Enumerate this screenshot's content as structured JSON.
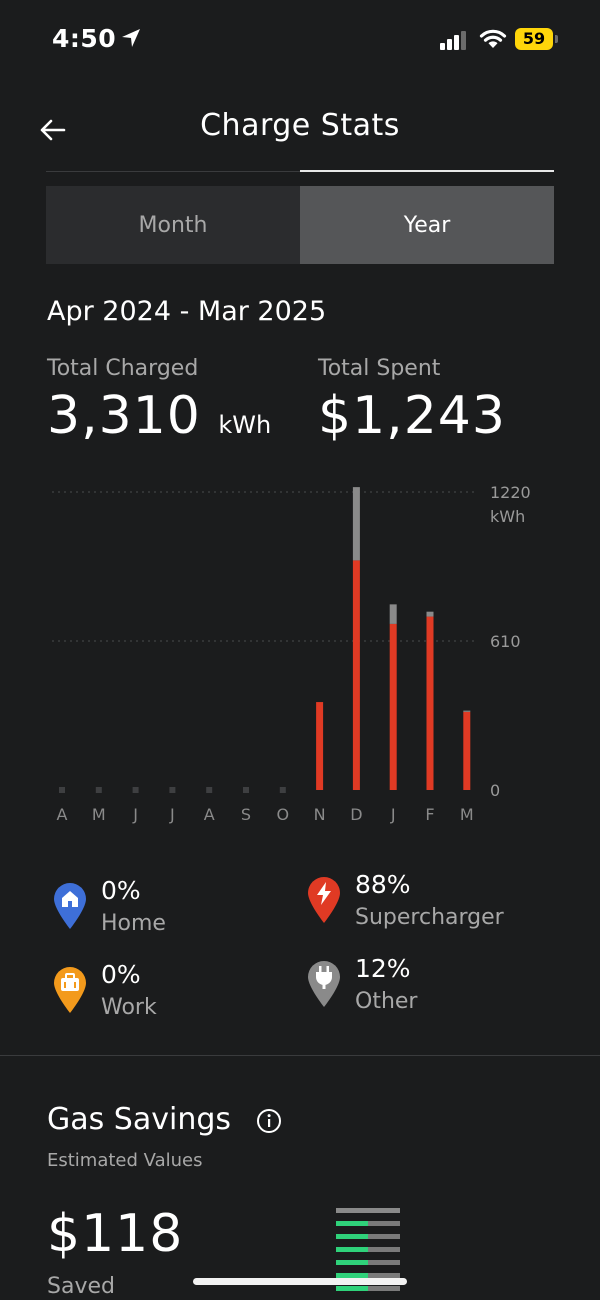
{
  "status_bar": {
    "time": "4:50",
    "battery": "59"
  },
  "header": {
    "title": "Charge Stats"
  },
  "tabs": [
    {
      "label": "Month",
      "active": false
    },
    {
      "label": "Year",
      "active": true
    }
  ],
  "period": "Apr 2024 - Mar 2025",
  "stats": {
    "charged_label": "Total Charged",
    "charged_value": "3,310",
    "charged_unit": "kWh",
    "spent_label": "Total Spent",
    "spent_value": "$1,243"
  },
  "chart_data": {
    "type": "bar",
    "categories": [
      "A",
      "M",
      "J",
      "J",
      "A",
      "S",
      "O",
      "N",
      "D",
      "J",
      "F",
      "M"
    ],
    "series": [
      {
        "values": [
          0,
          0,
          0,
          0,
          0,
          0,
          0,
          360,
          940,
          680,
          710,
          320
        ]
      },
      {
        "values": [
          0,
          0,
          0,
          0,
          0,
          0,
          0,
          0,
          300,
          80,
          20,
          5
        ]
      }
    ],
    "ylim": [
      0,
      1220
    ],
    "yticks": [
      "1220",
      "610",
      "0"
    ],
    "yunit": "kWh",
    "colors": [
      "#e03a24",
      "#8a8a8a"
    ],
    "grid": true
  },
  "legend": [
    {
      "pct": "0%",
      "name": "Home",
      "color": "#3e6fd8",
      "icon": "home-icon"
    },
    {
      "pct": "88%",
      "name": "Supercharger",
      "color": "#e03a24",
      "icon": "lightning-icon"
    },
    {
      "pct": "0%",
      "name": "Work",
      "color": "#f39a1c",
      "icon": "briefcase-icon"
    },
    {
      "pct": "12%",
      "name": "Other",
      "color": "#8a8a8a",
      "icon": "plug-icon"
    }
  ],
  "gas_savings": {
    "title": "Gas Savings",
    "subtitle": "Estimated Values",
    "saved_value": "$118",
    "saved_label": "Saved"
  }
}
